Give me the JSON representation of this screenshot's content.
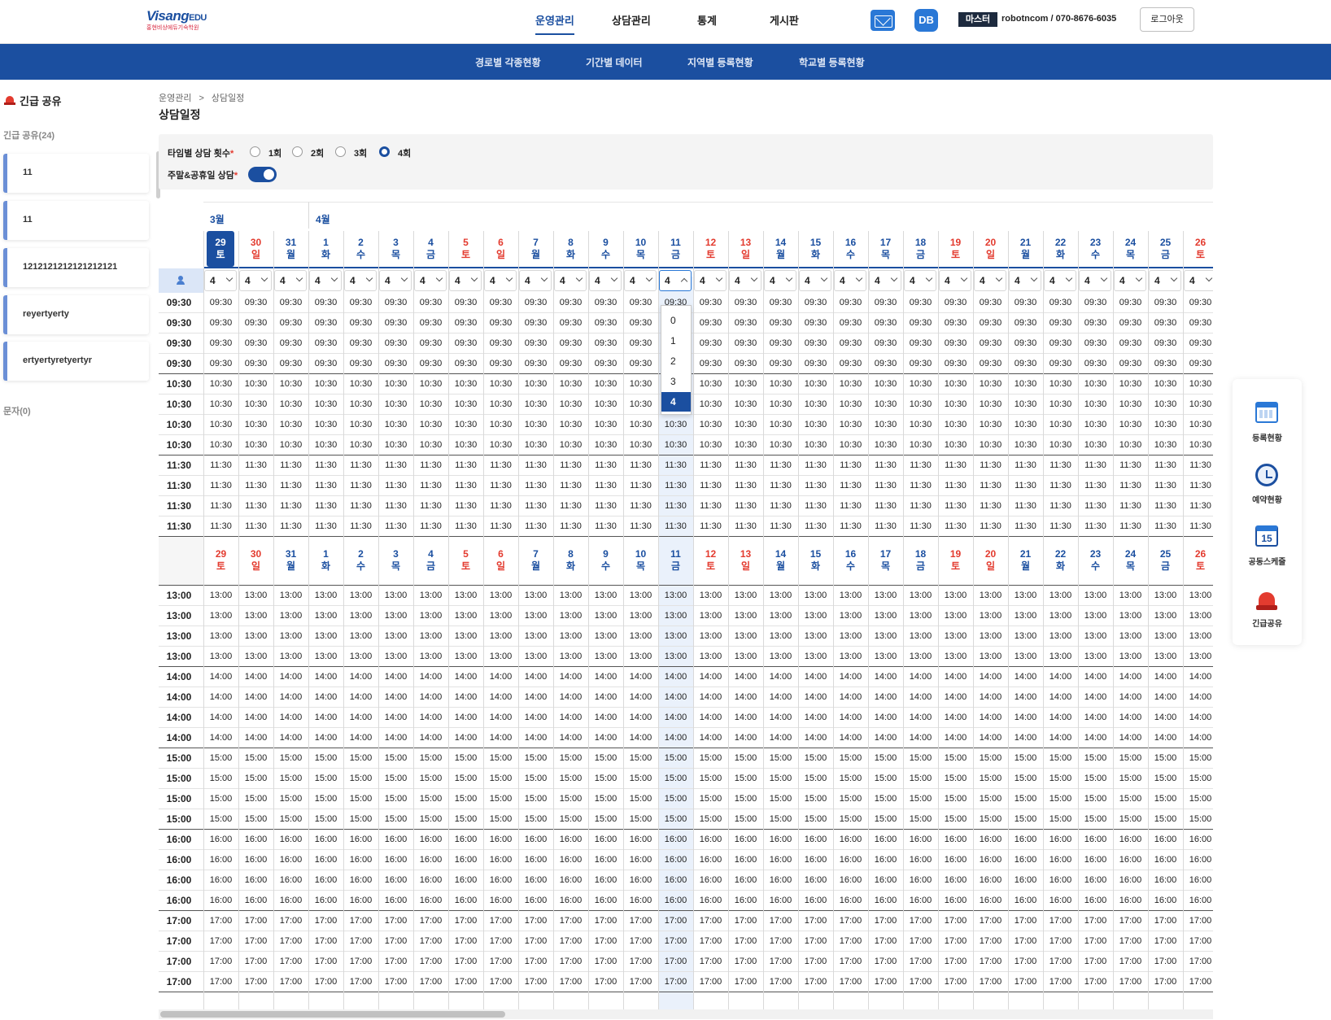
{
  "header": {
    "logo_main": "Visang",
    "logo_edu": "EDU",
    "logo_sub": "홍현비상에듀기숙학원",
    "nav": [
      "운영관리",
      "상담관리",
      "통계",
      "게시판"
    ],
    "db_label": "DB",
    "role_badge": "마스터",
    "user_info": "robotncom  /  070-8676-6035",
    "logout_label": "로그아웃"
  },
  "subnav": [
    "경로별 각종현황",
    "기간별 데이터",
    "지역별 등록현황",
    "학교별 등록현황"
  ],
  "sidebar": {
    "title": "긴급 공유",
    "section": "긴급 공유(24)",
    "items": [
      "11",
      "11",
      "1212121212121212121",
      "reyertyerty",
      "ertyertyretyertyr"
    ],
    "section2": "문자(0)"
  },
  "breadcrumb": {
    "root": "운영관리",
    "separator": ">",
    "current": "상담일정"
  },
  "page_title": "상담일정",
  "options": {
    "per_time_label": "타임별 상담 횟수",
    "per_time_choices": [
      "1회",
      "2회",
      "3회",
      "4회"
    ],
    "per_time_selected": "4회",
    "weekend_label": "주말&공휴일 상담",
    "weekend_enabled": true
  },
  "schedule": {
    "months": [
      "3월",
      "4월"
    ],
    "days": [
      {
        "d": "29",
        "w": "토"
      },
      {
        "d": "30",
        "w": "일"
      },
      {
        "d": "31",
        "w": "월"
      },
      {
        "d": "1",
        "w": "화"
      },
      {
        "d": "2",
        "w": "수"
      },
      {
        "d": "3",
        "w": "목"
      },
      {
        "d": "4",
        "w": "금"
      },
      {
        "d": "5",
        "w": "토"
      },
      {
        "d": "6",
        "w": "일"
      },
      {
        "d": "7",
        "w": "월"
      },
      {
        "d": "8",
        "w": "화"
      },
      {
        "d": "9",
        "w": "수"
      },
      {
        "d": "10",
        "w": "목"
      },
      {
        "d": "11",
        "w": "금"
      },
      {
        "d": "12",
        "w": "토"
      },
      {
        "d": "13",
        "w": "일"
      },
      {
        "d": "14",
        "w": "월"
      },
      {
        "d": "15",
        "w": "화"
      },
      {
        "d": "16",
        "w": "수"
      },
      {
        "d": "17",
        "w": "목"
      },
      {
        "d": "18",
        "w": "금"
      },
      {
        "d": "19",
        "w": "토"
      },
      {
        "d": "20",
        "w": "일"
      },
      {
        "d": "21",
        "w": "월"
      },
      {
        "d": "22",
        "w": "화"
      },
      {
        "d": "23",
        "w": "수"
      },
      {
        "d": "24",
        "w": "목"
      },
      {
        "d": "25",
        "w": "금"
      },
      {
        "d": "26",
        "w": "토"
      }
    ],
    "selected_day": "29",
    "highlight_day": "11",
    "count_value": "4",
    "morning_times": [
      "09:30",
      "10:30",
      "11:30"
    ],
    "afternoon_times": [
      "13:00",
      "14:00",
      "15:00",
      "16:00",
      "17:00"
    ],
    "slots_per_time": 4,
    "dropdown_options": [
      "0",
      "1",
      "2",
      "3",
      "4"
    ],
    "dropdown_selected": "4"
  },
  "colors": {
    "primary": "#1b4fa0",
    "weekend": "#e33b2f",
    "highlight": "#eaf1fb"
  },
  "quick_menu": [
    {
      "icon": "calendar-icon",
      "label": "등록현황"
    },
    {
      "icon": "alarm-clock-icon",
      "label": "예약현황"
    },
    {
      "icon": "calendar-15-icon",
      "label": "공동스케줄",
      "badge": "15"
    },
    {
      "icon": "siren-icon",
      "label": "긴급공유"
    }
  ]
}
